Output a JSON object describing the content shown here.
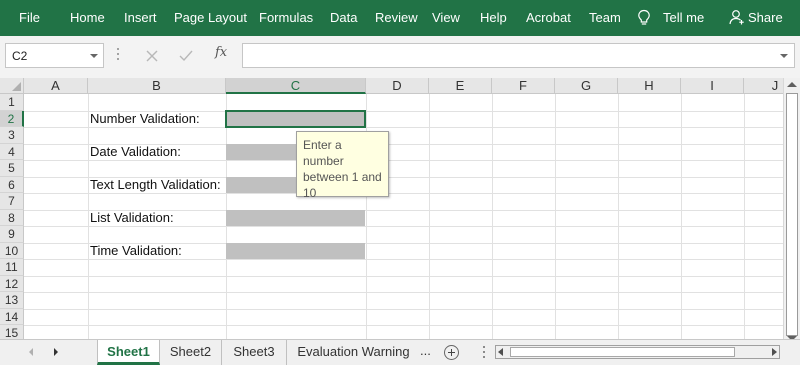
{
  "ribbon": {
    "tabs": [
      "File",
      "Home",
      "Insert",
      "Page Layout",
      "Formulas",
      "Data",
      "Review",
      "View",
      "Help",
      "Acrobat",
      "Team"
    ],
    "tell_me": "Tell me",
    "share": "Share",
    "color": "#217346"
  },
  "formula_bar": {
    "name_box": "C2",
    "fx_label": "fx",
    "formula": ""
  },
  "grid": {
    "columns": [
      "A",
      "B",
      "C",
      "D",
      "E",
      "F",
      "G",
      "H",
      "I",
      "J"
    ],
    "rows": [
      "1",
      "2",
      "3",
      "4",
      "5",
      "6",
      "7",
      "8",
      "9",
      "10",
      "11",
      "12",
      "13",
      "14",
      "15"
    ],
    "selected_column": "C",
    "selected_row": "2",
    "labels": [
      {
        "row": "2",
        "text": "Number Validation:"
      },
      {
        "row": "4",
        "text": "Date Validation:"
      },
      {
        "row": "6",
        "text": "Text Length Validation:"
      },
      {
        "row": "8",
        "text": "List Validation:"
      },
      {
        "row": "10",
        "text": "Time Validation:"
      }
    ],
    "tooltip": "Enter a number between 1 and 10"
  },
  "sheet_tabs": {
    "tabs": [
      "Sheet1",
      "Sheet2",
      "Sheet3",
      "Evaluation Warning"
    ],
    "active": "Sheet1",
    "more": "..."
  }
}
